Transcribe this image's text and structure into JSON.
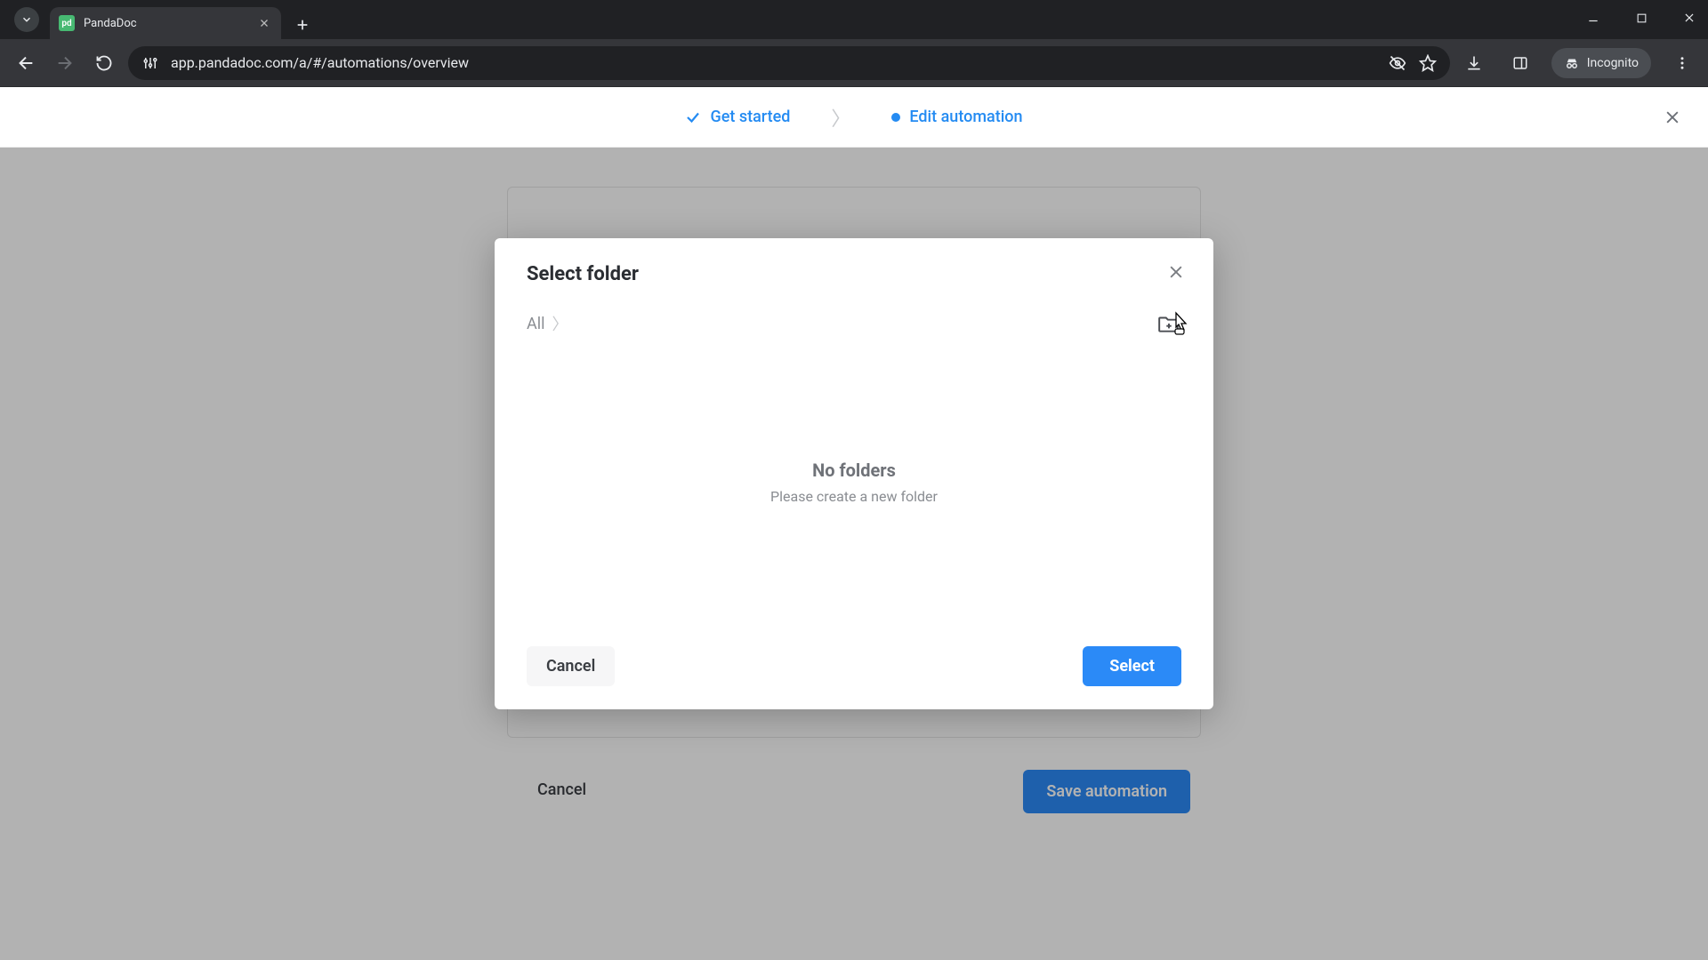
{
  "browser": {
    "tab_title": "PandaDoc",
    "url": "app.pandadoc.com/a/#/automations/overview",
    "incognito_label": "Incognito"
  },
  "wizard": {
    "step1": "Get started",
    "step2": "Edit automation"
  },
  "background": {
    "cancel": "Cancel",
    "save": "Save automation"
  },
  "modal": {
    "title": "Select folder",
    "breadcrumb_root": "All",
    "empty_title": "No folders",
    "empty_subtitle": "Please create a new folder",
    "cancel": "Cancel",
    "select": "Select"
  }
}
